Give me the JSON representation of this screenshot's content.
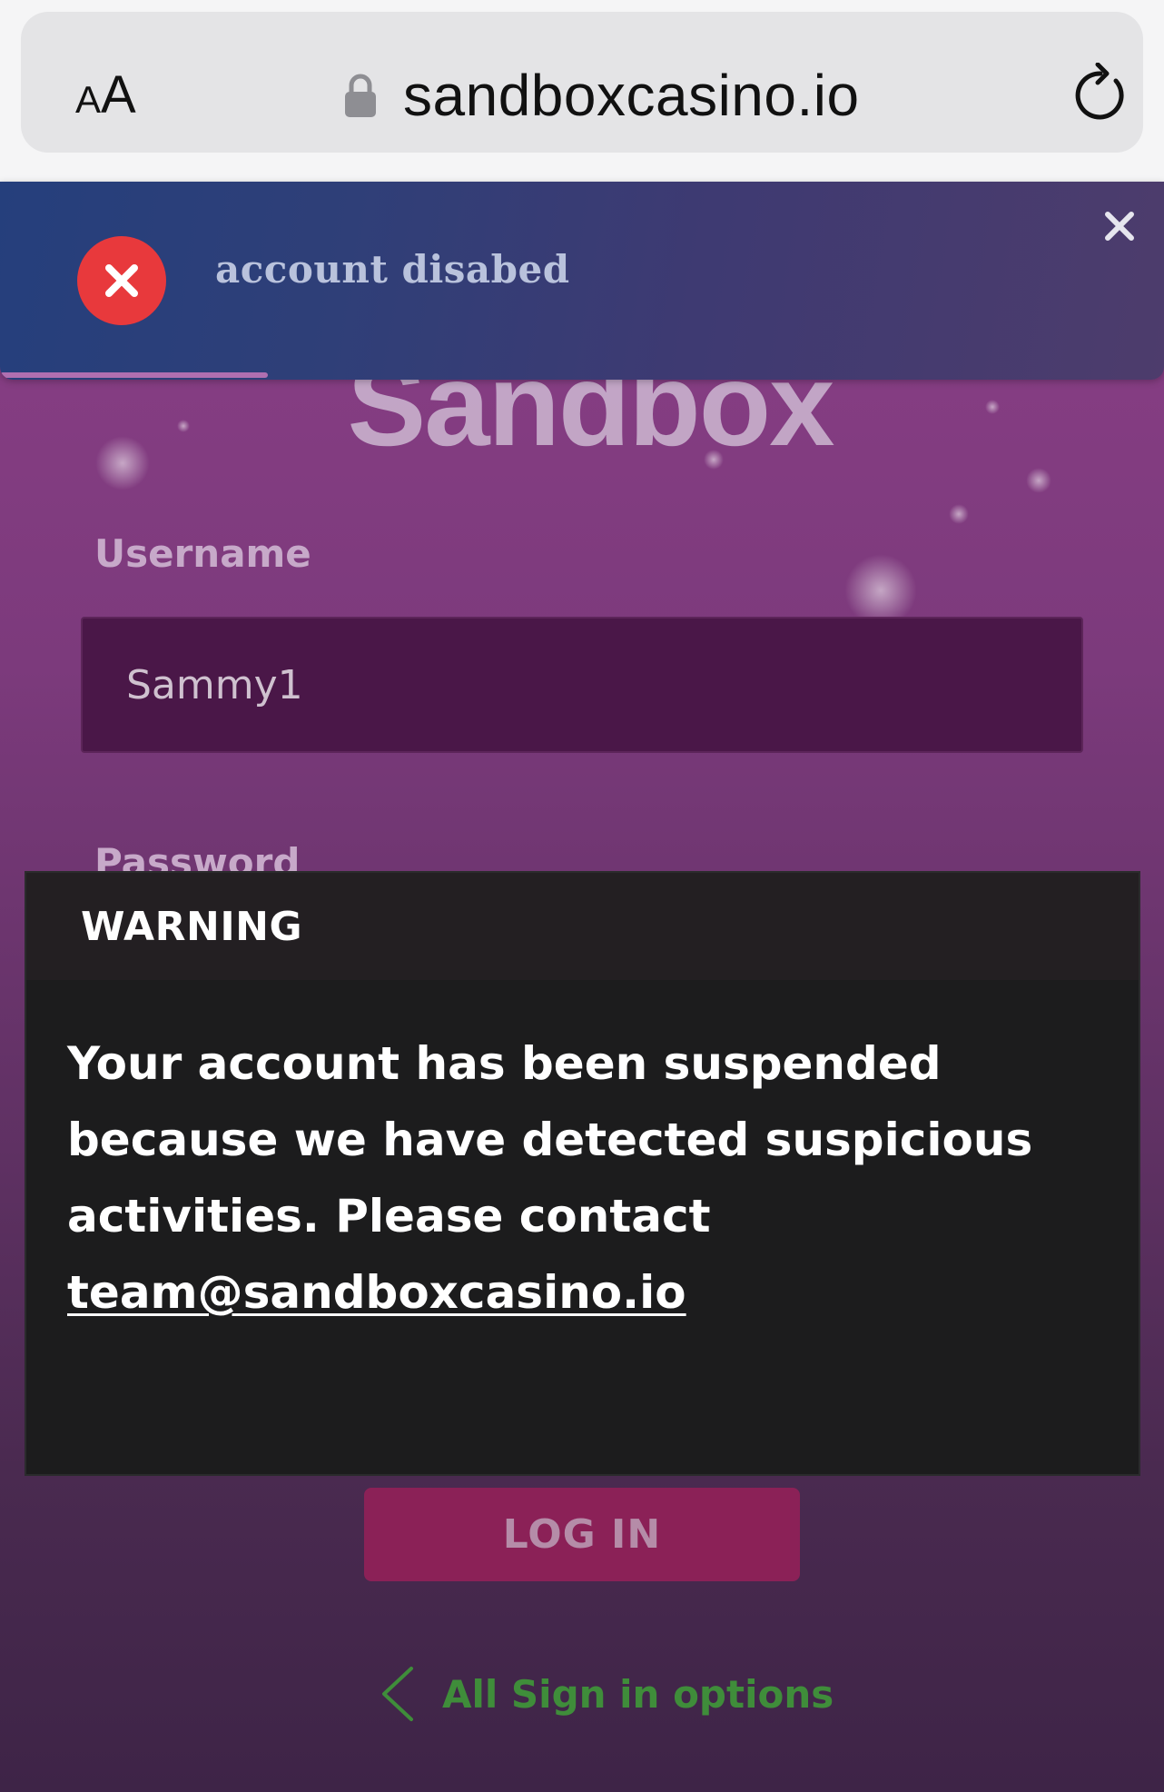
{
  "browser": {
    "text_size_label_small": "A",
    "text_size_label_big": "A",
    "url": "sandboxcasino.io"
  },
  "page": {
    "logo_text": "Sandbox",
    "username_label": "Username",
    "username_value": "Sammy1",
    "password_label": "Password",
    "login_button": "LOG IN",
    "signin_options": "All Sign in options"
  },
  "toast": {
    "message": "account disabed",
    "progress": 0.23,
    "colors": {
      "icon": "#e8393c",
      "background": "#2f3f78"
    }
  },
  "warning": {
    "title": "WARNING",
    "body": "Your account has been suspended because we have detected suspicious activities. Please contact",
    "email": "team@sandboxcasino.io"
  },
  "icons": [
    "lock-icon",
    "reload-icon",
    "error-icon",
    "close-icon",
    "chevron-left-icon"
  ]
}
